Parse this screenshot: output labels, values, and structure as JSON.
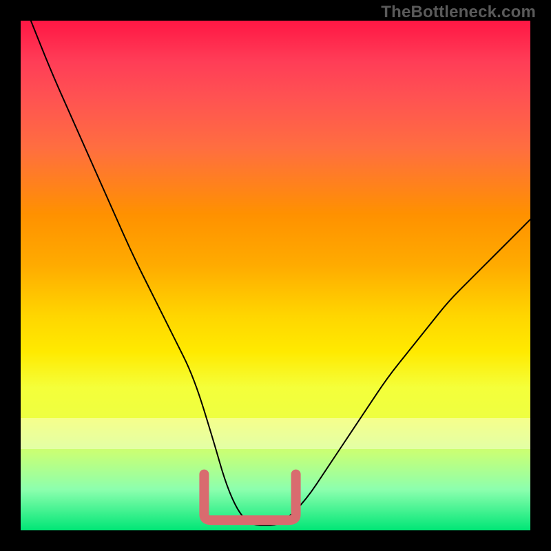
{
  "watermark": "TheBottleneck.com",
  "chart_data": {
    "type": "line",
    "title": "",
    "xlabel": "",
    "ylabel": "",
    "xlim": [
      0,
      100
    ],
    "ylim": [
      0,
      100
    ],
    "series": [
      {
        "name": "bottleneck-curve",
        "x": [
          2,
          6,
          10,
          14,
          18,
          22,
          26,
          30,
          34,
          38,
          40,
          42,
          44,
          46,
          48,
          50,
          52,
          56,
          60,
          64,
          68,
          72,
          76,
          80,
          84,
          88,
          92,
          96,
          100
        ],
        "values": [
          100,
          90,
          81,
          72,
          63,
          54,
          46,
          38,
          30,
          17,
          10,
          5,
          2,
          1,
          1,
          1,
          2,
          6,
          12,
          18,
          24,
          30,
          35,
          40,
          45,
          49,
          53,
          57,
          61
        ]
      }
    ],
    "annotations": [
      {
        "name": "sweet-spot",
        "shape": "flat-u",
        "x_range": [
          36,
          54
        ],
        "y_level": 2,
        "color": "#d96b6f"
      }
    ],
    "background_gradient": {
      "top": "#ff1744",
      "mid": "#ffea00",
      "bottom": "#00e676"
    }
  }
}
